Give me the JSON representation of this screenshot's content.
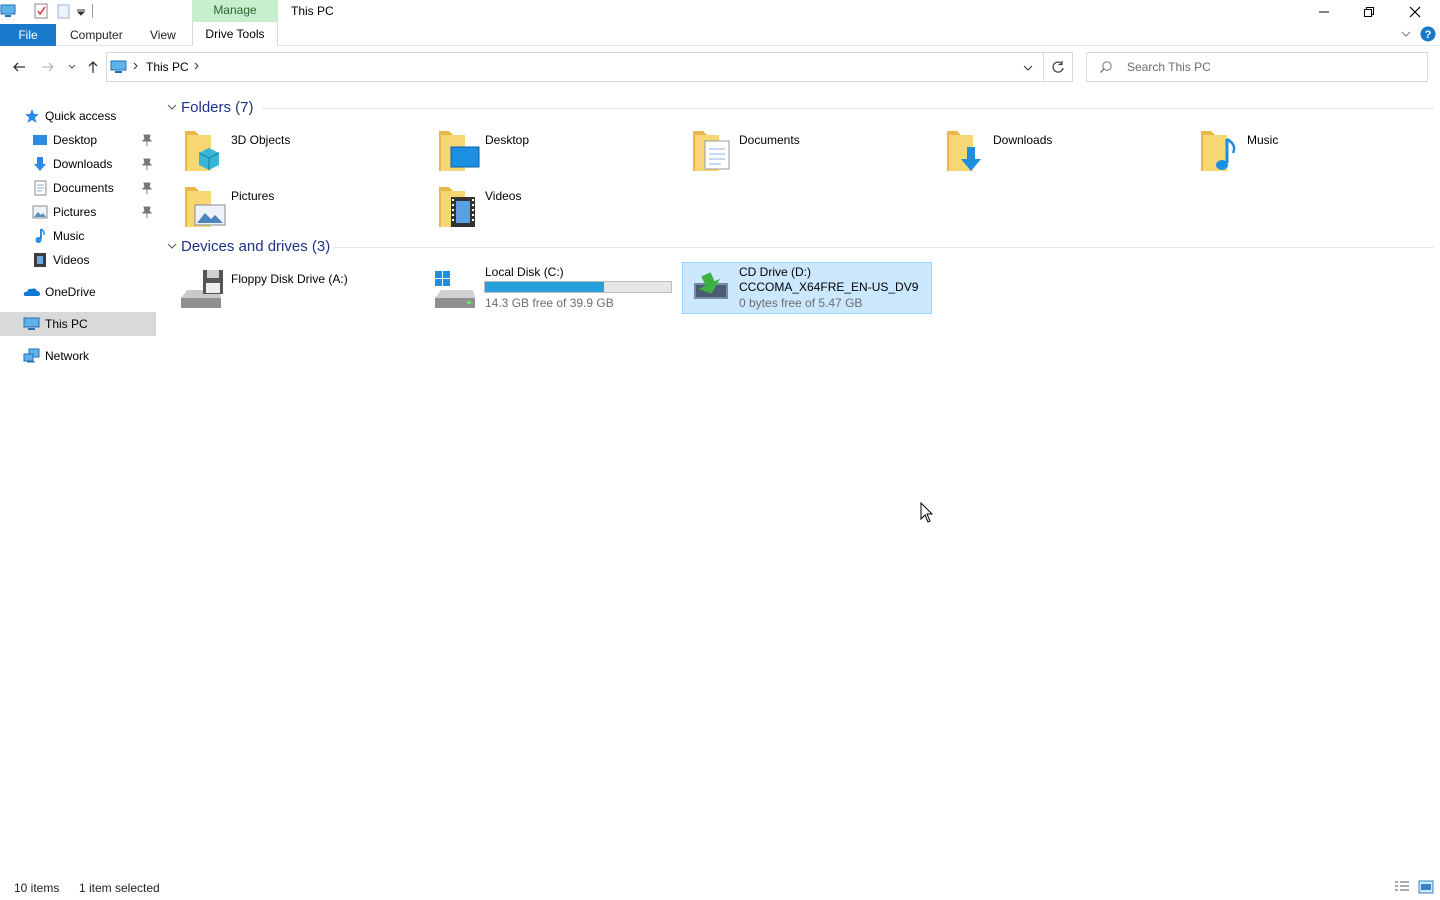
{
  "window": {
    "title": "This PC",
    "contextual_tab": "Manage"
  },
  "ribbon": {
    "file": "File",
    "tabs": [
      "Computer",
      "View"
    ],
    "drive_tools": "Drive Tools"
  },
  "address": {
    "path": "This PC",
    "search_placeholder": "Search This PC"
  },
  "sidebar": {
    "quick_access": "Quick access",
    "pinned": [
      {
        "label": "Desktop",
        "icon": "desktop-icon"
      },
      {
        "label": "Downloads",
        "icon": "downloads-icon"
      },
      {
        "label": "Documents",
        "icon": "documents-icon"
      },
      {
        "label": "Pictures",
        "icon": "pictures-icon"
      }
    ],
    "unpinned": [
      {
        "label": "Music",
        "icon": "music-icon"
      },
      {
        "label": "Videos",
        "icon": "videos-icon"
      }
    ],
    "onedrive": "OneDrive",
    "this_pc": "This PC",
    "network": "Network"
  },
  "folders": {
    "header": "Folders (7)",
    "items": [
      "3D Objects",
      "Desktop",
      "Documents",
      "Downloads",
      "Music",
      "Pictures",
      "Videos"
    ]
  },
  "devices": {
    "header": "Devices and drives (3)",
    "floppy": {
      "name": "Floppy Disk Drive (A:)"
    },
    "local": {
      "name": "Local Disk (C:)",
      "free": "14.3 GB free of 39.9 GB",
      "used_fraction": 0.64
    },
    "cd": {
      "name": "CD Drive (D:)",
      "label": "CCCOMA_X64FRE_EN-US_DV9",
      "free": "0 bytes free of 5.47 GB"
    }
  },
  "status": {
    "items": "10 items",
    "selected": "1 item selected"
  },
  "colors": {
    "accent": "#1979ca",
    "selection": "#cce8ff",
    "header_text": "#1e3287",
    "progress": "#26a0da",
    "manage_tab": "#c6efce"
  }
}
